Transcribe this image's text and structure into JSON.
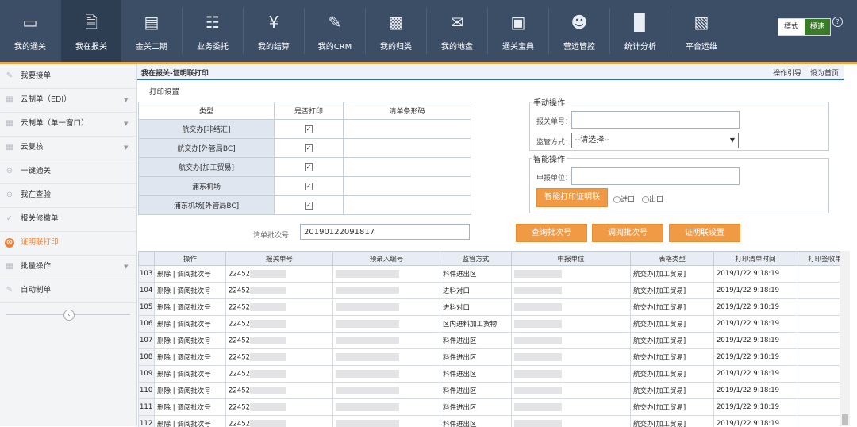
{
  "nav": {
    "items": [
      {
        "label": "我的通关",
        "icon": "monitor-icon"
      },
      {
        "label": "我在报关",
        "icon": "document-icon"
      },
      {
        "label": "金关二期",
        "icon": "computer-icon"
      },
      {
        "label": "业务委托",
        "icon": "clipboard-icon"
      },
      {
        "label": "我的结算",
        "icon": "yen-icon"
      },
      {
        "label": "我的CRM",
        "icon": "pencil-icon"
      },
      {
        "label": "我的归类",
        "icon": "book-icon"
      },
      {
        "label": "我的地盘",
        "icon": "chat-icon"
      },
      {
        "label": "通关宝典",
        "icon": "box-icon"
      },
      {
        "label": "营运管控",
        "icon": "users-icon"
      },
      {
        "label": "统计分析",
        "icon": "bar-chart-icon"
      },
      {
        "label": "平台运维",
        "icon": "admin-icon"
      }
    ],
    "active_index": 1,
    "mode_standard": "標式",
    "mode_fast": "極速",
    "help": "?"
  },
  "sidebar": {
    "items": [
      {
        "label": "我要接单",
        "arrow": false
      },
      {
        "label": "云制单（EDI）",
        "arrow": true
      },
      {
        "label": "云制单（单一窗口）",
        "arrow": true
      },
      {
        "label": "云复核",
        "arrow": true
      },
      {
        "label": "一键通关",
        "arrow": false
      },
      {
        "label": "我在查验",
        "arrow": false
      },
      {
        "label": "报关修撤单",
        "arrow": false
      },
      {
        "label": "证明联打印",
        "arrow": false
      },
      {
        "label": "批量操作",
        "arrow": true
      },
      {
        "label": "自动制单",
        "arrow": false
      }
    ],
    "active_index": 7,
    "collapse_glyph": "‹"
  },
  "breadcrumb": {
    "title": "我在报关-证明联打印",
    "links": [
      "操作引导",
      "设为首页"
    ]
  },
  "print_settings": {
    "title": "打印设置",
    "headers": [
      "类型",
      "是否打印",
      "清单条形码"
    ],
    "rows": [
      {
        "name": "航交办[非结汇]",
        "checked": true
      },
      {
        "name": "航交办[外管局BC]",
        "checked": true
      },
      {
        "name": "航交办[加工贸易]",
        "checked": true
      },
      {
        "name": "浦东机场",
        "checked": true
      },
      {
        "name": "浦东机场[外管局BC]",
        "checked": true
      }
    ]
  },
  "manual": {
    "legend": "手动操作",
    "customs_no_label": "报关单号：",
    "supervision_label": "监管方式：",
    "supervision_value": "--请选择--"
  },
  "smart": {
    "legend": "智能操作",
    "declarant_label": "申报单位：",
    "button": "智能打印证明联",
    "import_label": "进口",
    "export_label": "出口"
  },
  "batch": {
    "label": "清单批次号",
    "value": "20190122091817",
    "query_button": "查询批次号",
    "adjust_button": "调阅批次号",
    "settings_button": "证明联设置"
  },
  "grid": {
    "headers": [
      "",
      "操作",
      "报关单号",
      "预录入编号",
      "监管方式",
      "申报单位",
      "表格类型",
      "打印清单时间",
      "打印签收单"
    ],
    "rows": [
      {
        "no": "103",
        "op": "删除 | 调阅批次号",
        "decl": "22452",
        "mode": "料件进出区",
        "type": "航交办[加工贸易]",
        "time": "2019/1/22 9:18:19"
      },
      {
        "no": "104",
        "op": "删除 | 调阅批次号",
        "decl": "22452",
        "mode": "进料对口",
        "type": "航交办[加工贸易]",
        "time": "2019/1/22 9:18:19"
      },
      {
        "no": "105",
        "op": "删除 | 调阅批次号",
        "decl": "22452",
        "mode": "进料对口",
        "type": "航交办[加工贸易]",
        "time": "2019/1/22 9:18:19"
      },
      {
        "no": "106",
        "op": "删除 | 调阅批次号",
        "decl": "22452",
        "mode": "区内进料加工货物",
        "type": "航交办[加工贸易]",
        "time": "2019/1/22 9:18:19"
      },
      {
        "no": "107",
        "op": "删除 | 调阅批次号",
        "decl": "22452",
        "mode": "料件进出区",
        "type": "航交办[加工贸易]",
        "time": "2019/1/22 9:18:19"
      },
      {
        "no": "108",
        "op": "删除 | 调阅批次号",
        "decl": "22452",
        "mode": "料件进出区",
        "type": "航交办[加工贸易]",
        "time": "2019/1/22 9:18:19"
      },
      {
        "no": "109",
        "op": "删除 | 调阅批次号",
        "decl": "22452",
        "mode": "料件进出区",
        "type": "航交办[加工贸易]",
        "time": "2019/1/22 9:18:19"
      },
      {
        "no": "110",
        "op": "删除 | 调阅批次号",
        "decl": "22452",
        "mode": "料件进出区",
        "type": "航交办[加工贸易]",
        "time": "2019/1/22 9:18:19"
      },
      {
        "no": "111",
        "op": "删除 | 调阅批次号",
        "decl": "22452",
        "mode": "料件进出区",
        "type": "航交办[加工贸易]",
        "time": "2019/1/22 9:18:19"
      },
      {
        "no": "112",
        "op": "删除 | 调阅批次号",
        "decl": "22452",
        "mode": "料件进出区",
        "type": "航交办[加工贸易]",
        "time": "2019/1/22 9:18:19"
      }
    ]
  }
}
